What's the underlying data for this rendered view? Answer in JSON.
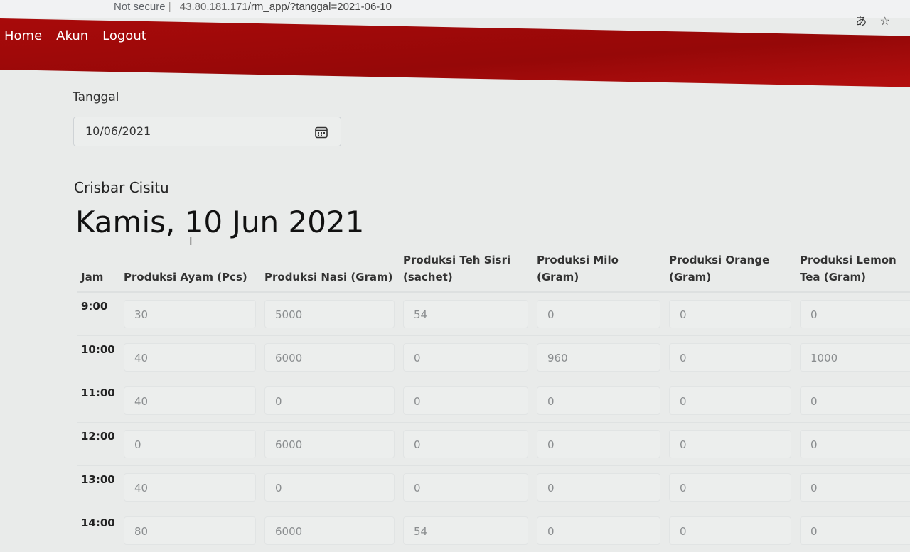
{
  "browser": {
    "security": "Not secure",
    "host": "43.80.181.171",
    "path": "/rm_app/?tanggal=2021-06-10",
    "translate_icon": "translate-icon",
    "bookmark_icon": "bookmark-star-icon"
  },
  "nav": {
    "items": [
      "Home",
      "Akun",
      "Logout"
    ]
  },
  "form": {
    "date_label": "Tanggal",
    "date_value": "10/06/2021",
    "calendar_icon": "calendar-icon"
  },
  "store_name": "Crisbar Cisitu",
  "page_title": "Kamis, 10 Jun 2021",
  "colors": {
    "navbar": "#a80a0a",
    "page_bg": "#e9ebea"
  },
  "table": {
    "headers": [
      "Jam",
      "Produksi Ayam (Pcs)",
      "Produksi Nasi (Gram)",
      "Produksi Teh Sisri (sachet)",
      "Produksi Milo (Gram)",
      "Produksi Orange (Gram)",
      "Produksi Lemon Tea (Gram)"
    ],
    "rows": [
      {
        "jam": "9:00",
        "values": [
          "30",
          "5000",
          "54",
          "0",
          "0",
          "0"
        ]
      },
      {
        "jam": "10:00",
        "values": [
          "40",
          "6000",
          "0",
          "960",
          "0",
          "1000"
        ]
      },
      {
        "jam": "11:00",
        "values": [
          "40",
          "0",
          "0",
          "0",
          "0",
          "0"
        ]
      },
      {
        "jam": "12:00",
        "values": [
          "0",
          "6000",
          "0",
          "0",
          "0",
          "0"
        ]
      },
      {
        "jam": "13:00",
        "values": [
          "40",
          "0",
          "0",
          "0",
          "0",
          "0"
        ]
      },
      {
        "jam": "14:00",
        "values": [
          "80",
          "6000",
          "54",
          "0",
          "0",
          "0"
        ]
      }
    ]
  }
}
